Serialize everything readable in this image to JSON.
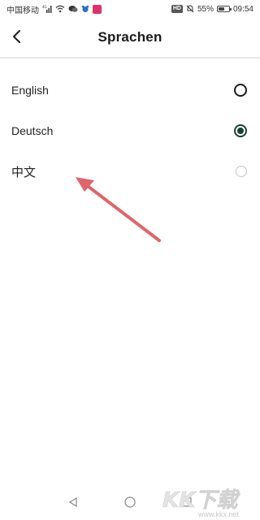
{
  "status_bar": {
    "carrier": "中国移动",
    "network": "4G",
    "battery_percent": "55%",
    "battery_level": 0.55,
    "time": "09:54",
    "hd_label": "HD"
  },
  "header": {
    "title": "Sprachen",
    "back_icon": "chevron-left-icon"
  },
  "languages": [
    {
      "label": "English",
      "selected": false
    },
    {
      "label": "Deutsch",
      "selected": true
    },
    {
      "label": "中文",
      "selected": false
    }
  ],
  "colors": {
    "accent": "#1a4030",
    "annotation_arrow": "#e0656a",
    "divider": "#e6e6e6"
  },
  "nav_bar": {
    "icons": [
      "back-triangle-icon",
      "home-circle-icon",
      "recents-square-icon"
    ]
  },
  "watermark": {
    "logo_text": "KK下载",
    "url": "www.kkx.net"
  }
}
